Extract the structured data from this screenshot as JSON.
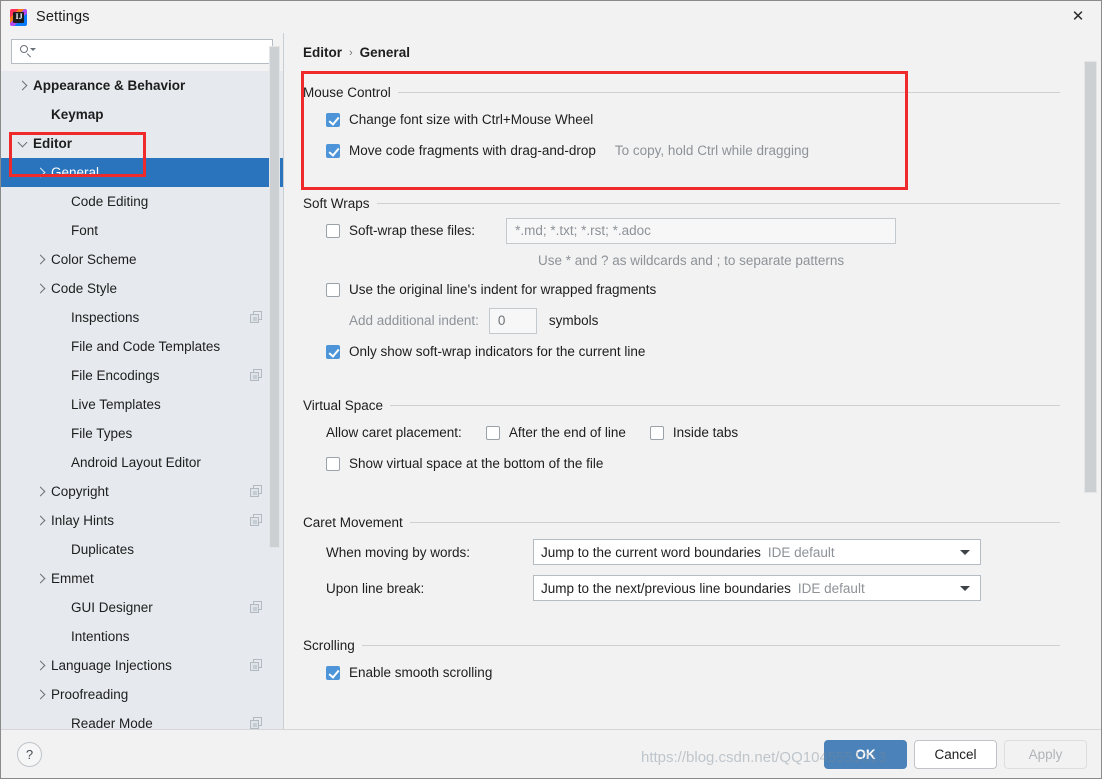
{
  "window": {
    "title": "Settings",
    "logo_icon": "intellij-idea-logo",
    "close_icon": "close-icon",
    "close_label": "✕"
  },
  "sidebar": {
    "search": {
      "placeholder": "",
      "value": "",
      "icon": "search-icon"
    },
    "items": [
      {
        "label": "Appearance & Behavior",
        "arrow": "right",
        "bold": true,
        "indent": 0,
        "copy": false,
        "selected": false
      },
      {
        "label": "Keymap",
        "arrow": "none",
        "bold": true,
        "indent": 1,
        "copy": false,
        "selected": false
      },
      {
        "label": "Editor",
        "arrow": "down",
        "bold": true,
        "indent": 0,
        "copy": false,
        "selected": false
      },
      {
        "label": "General",
        "arrow": "right",
        "bold": false,
        "indent": 1,
        "copy": false,
        "selected": true
      },
      {
        "label": "Code Editing",
        "arrow": "none",
        "bold": false,
        "indent": 2,
        "copy": false,
        "selected": false
      },
      {
        "label": "Font",
        "arrow": "none",
        "bold": false,
        "indent": 2,
        "copy": false,
        "selected": false
      },
      {
        "label": "Color Scheme",
        "arrow": "right",
        "bold": false,
        "indent": 1,
        "copy": false,
        "selected": false
      },
      {
        "label": "Code Style",
        "arrow": "right",
        "bold": false,
        "indent": 1,
        "copy": false,
        "selected": false
      },
      {
        "label": "Inspections",
        "arrow": "none",
        "bold": false,
        "indent": 2,
        "copy": true,
        "selected": false
      },
      {
        "label": "File and Code Templates",
        "arrow": "none",
        "bold": false,
        "indent": 2,
        "copy": false,
        "selected": false
      },
      {
        "label": "File Encodings",
        "arrow": "none",
        "bold": false,
        "indent": 2,
        "copy": true,
        "selected": false
      },
      {
        "label": "Live Templates",
        "arrow": "none",
        "bold": false,
        "indent": 2,
        "copy": false,
        "selected": false
      },
      {
        "label": "File Types",
        "arrow": "none",
        "bold": false,
        "indent": 2,
        "copy": false,
        "selected": false
      },
      {
        "label": "Android Layout Editor",
        "arrow": "none",
        "bold": false,
        "indent": 2,
        "copy": false,
        "selected": false
      },
      {
        "label": "Copyright",
        "arrow": "right",
        "bold": false,
        "indent": 1,
        "copy": true,
        "selected": false
      },
      {
        "label": "Inlay Hints",
        "arrow": "right",
        "bold": false,
        "indent": 1,
        "copy": true,
        "selected": false
      },
      {
        "label": "Duplicates",
        "arrow": "none",
        "bold": false,
        "indent": 2,
        "copy": false,
        "selected": false
      },
      {
        "label": "Emmet",
        "arrow": "right",
        "bold": false,
        "indent": 1,
        "copy": false,
        "selected": false
      },
      {
        "label": "GUI Designer",
        "arrow": "none",
        "bold": false,
        "indent": 2,
        "copy": true,
        "selected": false
      },
      {
        "label": "Intentions",
        "arrow": "none",
        "bold": false,
        "indent": 2,
        "copy": false,
        "selected": false
      },
      {
        "label": "Language Injections",
        "arrow": "right",
        "bold": false,
        "indent": 1,
        "copy": true,
        "selected": false
      },
      {
        "label": "Proofreading",
        "arrow": "right",
        "bold": false,
        "indent": 1,
        "copy": false,
        "selected": false
      },
      {
        "label": "Reader Mode",
        "arrow": "none",
        "bold": false,
        "indent": 2,
        "copy": true,
        "selected": false
      }
    ]
  },
  "breadcrumb": {
    "root": "Editor",
    "separator": "›",
    "leaf": "General"
  },
  "sections": {
    "mouse_control": {
      "title": "Mouse Control",
      "change_font_size": {
        "label": "Change font size with Ctrl+Mouse Wheel",
        "checked": true
      },
      "move_code_fragments": {
        "label": "Move code fragments with drag-and-drop",
        "checked": true
      },
      "move_code_hint": "To copy, hold Ctrl while dragging"
    },
    "soft_wraps": {
      "title": "Soft Wraps",
      "soft_wrap_files": {
        "label": "Soft-wrap these files:",
        "checked": false
      },
      "soft_wrap_field": {
        "value": "",
        "placeholder": "*.md; *.txt; *.rst; *.adoc"
      },
      "wildcard_hint": "Use * and ? as wildcards and ; to separate patterns",
      "original_indent": {
        "label": "Use the original line's indent for wrapped fragments",
        "checked": false
      },
      "additional_indent_label": "Add additional indent:",
      "additional_indent_value": "0",
      "symbols_label": "symbols",
      "only_show_indicators": {
        "label": "Only show soft-wrap indicators for the current line",
        "checked": true
      }
    },
    "virtual_space": {
      "title": "Virtual Space",
      "allow_caret_label": "Allow caret placement:",
      "after_end_of_line": {
        "label": "After the end of line",
        "checked": false
      },
      "inside_tabs": {
        "label": "Inside tabs",
        "checked": false
      },
      "show_virtual_space": {
        "label": "Show virtual space at the bottom of the file",
        "checked": false
      }
    },
    "caret_movement": {
      "title": "Caret Movement",
      "when_moving_by_words": {
        "label": "When moving by words:",
        "value": "Jump to the current word boundaries",
        "suffix": "IDE default"
      },
      "upon_line_break": {
        "label": "Upon line break:",
        "value": "Jump to the next/previous line boundaries",
        "suffix": "IDE default"
      }
    },
    "scrolling": {
      "title": "Scrolling",
      "enable_smooth_scrolling": {
        "label": "Enable smooth scrolling",
        "checked": true
      }
    }
  },
  "footer": {
    "help_label": "?",
    "ok_label": "OK",
    "cancel_label": "Cancel",
    "apply_label": "Apply"
  },
  "watermark": "https://blog.csdn.net/QQ1045551013",
  "colors": {
    "selection_blue": "#2a74bd",
    "checkbox_blue": "#4d95d8",
    "primary_button": "#4a82b9",
    "annotation_red": "#f02a2a",
    "sidebar_bg": "#e6eaee",
    "panel_bg": "#f2f2f2"
  }
}
